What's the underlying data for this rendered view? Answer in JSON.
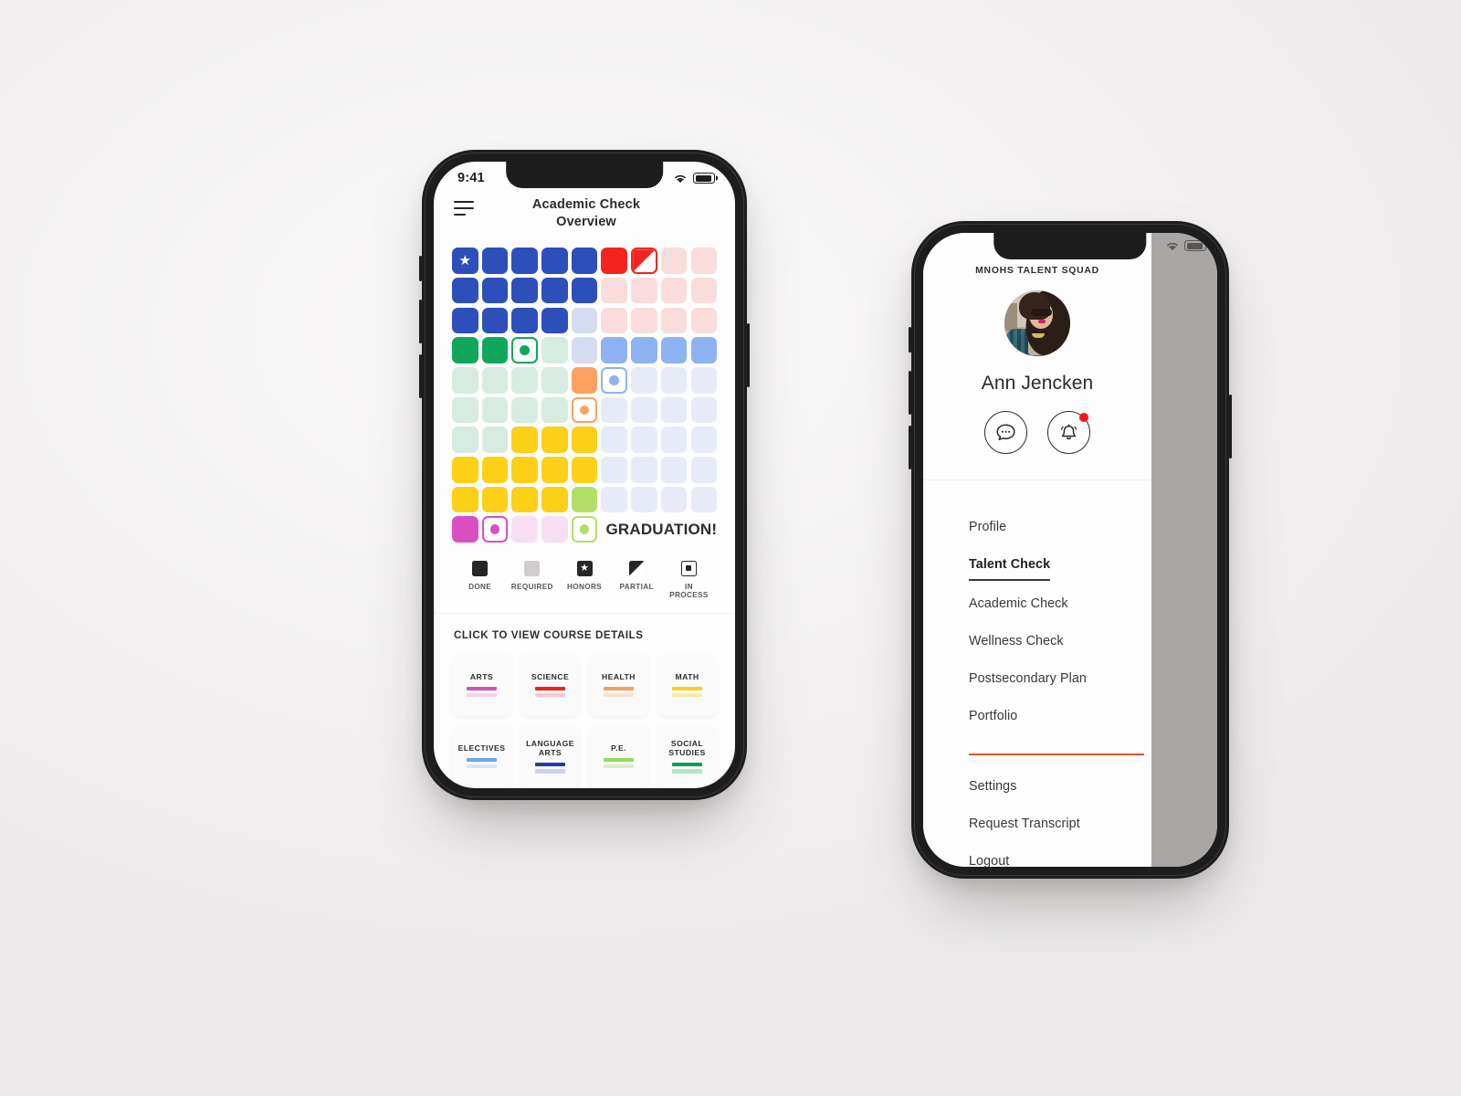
{
  "meta": {
    "page_background": "#f4f2f2",
    "accent_orange": "#e8562a"
  },
  "phone_left": {
    "status_bar": {
      "time": "9:41",
      "wifi_icon": "wifi-icon",
      "battery_icon": "battery-icon"
    },
    "header": {
      "menu_icon": "hamburger-menu-icon",
      "title": "Academic Check\nOverview"
    },
    "grid": {
      "columns": 9,
      "palette": {
        "blue": "#2d4fba",
        "blue_pale": "#d6dcf0",
        "red": "#f4231f",
        "red_pale": "#fbdcdc",
        "green": "#11a75a",
        "green_pale": "#d6ece0",
        "lightblue": "#8db3f2",
        "lavender_pale": "#e6ebf7",
        "orange": "#fba263",
        "yellow": "#fbd016",
        "lime": "#b2e066",
        "magenta": "#d94fc2",
        "magenta_pale": "#f6dff3"
      },
      "rows": [
        [
          {
            "c": "#2d4fba",
            "t": "star"
          },
          {
            "c": "#2d4fba"
          },
          {
            "c": "#2d4fba"
          },
          {
            "c": "#2d4fba"
          },
          {
            "c": "#2d4fba"
          },
          {
            "c": "#f4231f"
          },
          {
            "c": "#f4231f",
            "t": "partial"
          },
          {
            "c": "#fbdcdc"
          },
          {
            "c": "#fbdcdc"
          }
        ],
        [
          {
            "c": "#2d4fba"
          },
          {
            "c": "#2d4fba"
          },
          {
            "c": "#2d4fba"
          },
          {
            "c": "#2d4fba"
          },
          {
            "c": "#2d4fba"
          },
          {
            "c": "#fbdcdc"
          },
          {
            "c": "#fbdcdc"
          },
          {
            "c": "#fbdcdc"
          },
          {
            "c": "#fbdcdc"
          }
        ],
        [
          {
            "c": "#2d4fba"
          },
          {
            "c": "#2d4fba"
          },
          {
            "c": "#2d4fba"
          },
          {
            "c": "#2d4fba"
          },
          {
            "c": "#d6dcf0"
          },
          {
            "c": "#fbdcdc"
          },
          {
            "c": "#fbdcdc"
          },
          {
            "c": "#fbdcdc"
          },
          {
            "c": "#fbdcdc"
          }
        ],
        [
          {
            "c": "#11a75a"
          },
          {
            "c": "#11a75a"
          },
          {
            "c": "#11a75a",
            "t": "marked"
          },
          {
            "c": "#d6ece0"
          },
          {
            "c": "#d6dcf0"
          },
          {
            "c": "#8db3f2"
          },
          {
            "c": "#8db3f2"
          },
          {
            "c": "#8db3f2"
          },
          {
            "c": "#8db3f2"
          }
        ],
        [
          {
            "c": "#d6ece0"
          },
          {
            "c": "#d6ece0"
          },
          {
            "c": "#d6ece0"
          },
          {
            "c": "#d6ece0"
          },
          {
            "c": "#fba263"
          },
          {
            "c": "#8db3f2",
            "t": "marked"
          },
          {
            "c": "#e6ebf7"
          },
          {
            "c": "#e6ebf7"
          },
          {
            "c": "#e6ebf7"
          }
        ],
        [
          {
            "c": "#d6ece0"
          },
          {
            "c": "#d6ece0"
          },
          {
            "c": "#d6ece0"
          },
          {
            "c": "#d6ece0"
          },
          {
            "c": "#fba263",
            "t": "marked"
          },
          {
            "c": "#e6ebf7"
          },
          {
            "c": "#e6ebf7"
          },
          {
            "c": "#e6ebf7"
          },
          {
            "c": "#e6ebf7"
          }
        ],
        [
          {
            "c": "#d6ece0"
          },
          {
            "c": "#d6ece0"
          },
          {
            "c": "#fbd016"
          },
          {
            "c": "#fbd016"
          },
          {
            "c": "#fbd016"
          },
          {
            "c": "#e6ebf7"
          },
          {
            "c": "#e6ebf7"
          },
          {
            "c": "#e6ebf7"
          },
          {
            "c": "#e6ebf7"
          }
        ],
        [
          {
            "c": "#fbd016"
          },
          {
            "c": "#fbd016"
          },
          {
            "c": "#fbd016"
          },
          {
            "c": "#fbd016"
          },
          {
            "c": "#fbd016"
          },
          {
            "c": "#e6ebf7"
          },
          {
            "c": "#e6ebf7"
          },
          {
            "c": "#e6ebf7"
          },
          {
            "c": "#e6ebf7"
          }
        ],
        [
          {
            "c": "#fbd016"
          },
          {
            "c": "#fbd016"
          },
          {
            "c": "#fbd016"
          },
          {
            "c": "#fbd016"
          },
          {
            "c": "#b2e066"
          },
          {
            "c": "#e6ebf7"
          },
          {
            "c": "#e6ebf7"
          },
          {
            "c": "#e6ebf7"
          },
          {
            "c": "#e6ebf7"
          }
        ]
      ],
      "final_row": [
        {
          "c": "#d94fc2"
        },
        {
          "c": "#d94fc2",
          "t": "marked"
        },
        {
          "c": "#f6dff3"
        },
        {
          "c": "#f6dff3"
        },
        {
          "c": "#b2e066",
          "t": "marked"
        }
      ],
      "graduation_label": "GRADUATION!"
    },
    "legend": [
      {
        "key": "done",
        "label": "DONE",
        "icon": "filled-square-icon"
      },
      {
        "key": "required",
        "label": "REQUIRED",
        "icon": "grey-square-icon"
      },
      {
        "key": "honors",
        "label": "HONORS",
        "icon": "star-square-icon"
      },
      {
        "key": "partial",
        "label": "PARTIAL",
        "icon": "half-square-icon"
      },
      {
        "key": "inprocess",
        "label": "IN\nPROCESS",
        "icon": "dot-square-icon"
      }
    ],
    "courses_heading": "CLICK TO VIEW COURSE DETAILS",
    "course_cards": [
      {
        "label": "ARTS",
        "bar_dark": "#d34fc6",
        "bar_light": "#f1d2f0"
      },
      {
        "label": "SCIENCE",
        "bar_dark": "#f41e1c",
        "bar_light": "#fbc9c6"
      },
      {
        "label": "HEALTH",
        "bar_dark": "#fb9e5b",
        "bar_light": "#fde0c8"
      },
      {
        "label": "MATH",
        "bar_dark": "#fbd016",
        "bar_light": "#fdeaa4"
      },
      {
        "label": "ELECTIVES",
        "bar_dark": "#6aa5f2",
        "bar_light": "#d7e4fa"
      },
      {
        "label": "LANGUAGE\nARTS",
        "bar_dark": "#2c35b0",
        "bar_light": "#ccd2f0"
      },
      {
        "label": "P.E.",
        "bar_dark": "#93dd5c",
        "bar_light": "#d7f0bf"
      },
      {
        "label": "SOCIAL\nSTUDIES",
        "bar_dark": "#07a153",
        "bar_light": "#b6e3c9"
      }
    ]
  },
  "phone_right": {
    "status_bar": {
      "wifi_icon": "wifi-icon",
      "battery_icon": "battery-icon"
    },
    "squad_name": "MNOHS TALENT SQUAD",
    "avatar_icon": "user-avatar-photo",
    "user_name": "Ann Jencken",
    "actions": [
      {
        "key": "messages",
        "icon": "chat-bubble-icon",
        "badge": false
      },
      {
        "key": "notifications",
        "icon": "bell-icon",
        "badge": true
      }
    ],
    "menu": {
      "primary": [
        {
          "label": "Profile",
          "active": false
        },
        {
          "label": "Talent Check",
          "active": true
        },
        {
          "label": "Academic Check",
          "active": false
        },
        {
          "label": "Wellness Check",
          "active": false
        },
        {
          "label": "Postsecondary Plan",
          "active": false
        },
        {
          "label": "Portfolio",
          "active": false
        }
      ],
      "secondary": [
        {
          "label": "Settings"
        },
        {
          "label": "Request Transcript"
        },
        {
          "label": "Logout"
        }
      ]
    }
  }
}
